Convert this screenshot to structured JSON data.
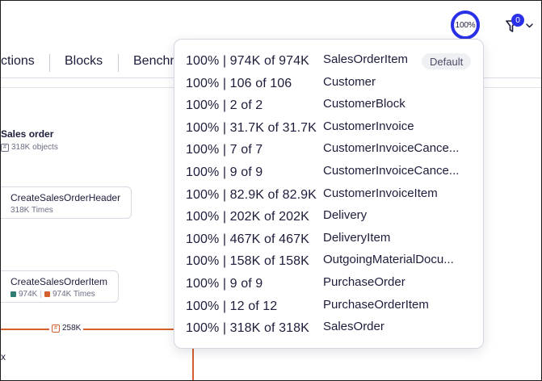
{
  "header": {
    "progress_label": "100%",
    "progress_fraction": 1.0,
    "filter_count": "0"
  },
  "tabs": [
    {
      "label": "ctions"
    },
    {
      "label": "Blocks"
    },
    {
      "label": "Benchm"
    }
  ],
  "canvas": {
    "sales_order": {
      "title": "Sales order",
      "objects": "318K objects"
    },
    "header_card": {
      "title": "CreateSalesOrderHeader",
      "times": "318K Times"
    },
    "item_card": {
      "title": "CreateSalesOrderItem",
      "count_a": "974K",
      "count_b": "974K Times"
    },
    "edge_label": "258K",
    "bottom_fragment": "x"
  },
  "colors": {
    "accent_blue": "#2930e8",
    "edge_orange": "#d4602f",
    "teal_square": "#2f7d72",
    "orange_square": "#d4602f"
  },
  "popover": {
    "default_badge": "Default",
    "rows": [
      {
        "stat": "100% | 974K of 974K",
        "name": "SalesOrderItem"
      },
      {
        "stat": "100% | 106 of 106",
        "name": "Customer"
      },
      {
        "stat": "100% | 2 of 2",
        "name": "CustomerBlock"
      },
      {
        "stat": "100% | 31.7K of 31.7K",
        "name": "CustomerInvoice"
      },
      {
        "stat": "100% | 7 of 7",
        "name": "CustomerInvoiceCance..."
      },
      {
        "stat": "100% | 9 of 9",
        "name": "CustomerInvoiceCance..."
      },
      {
        "stat": "100% | 82.9K of 82.9K",
        "name": "CustomerInvoiceItem"
      },
      {
        "stat": "100% | 202K of 202K",
        "name": "Delivery"
      },
      {
        "stat": "100% | 467K of 467K",
        "name": "DeliveryItem"
      },
      {
        "stat": "100% | 158K of 158K",
        "name": "OutgoingMaterialDocu..."
      },
      {
        "stat": "100% | 9 of 9",
        "name": "PurchaseOrder"
      },
      {
        "stat": "100% | 12 of 12",
        "name": "PurchaseOrderItem"
      },
      {
        "stat": "100% | 318K of 318K",
        "name": "SalesOrder"
      }
    ]
  }
}
